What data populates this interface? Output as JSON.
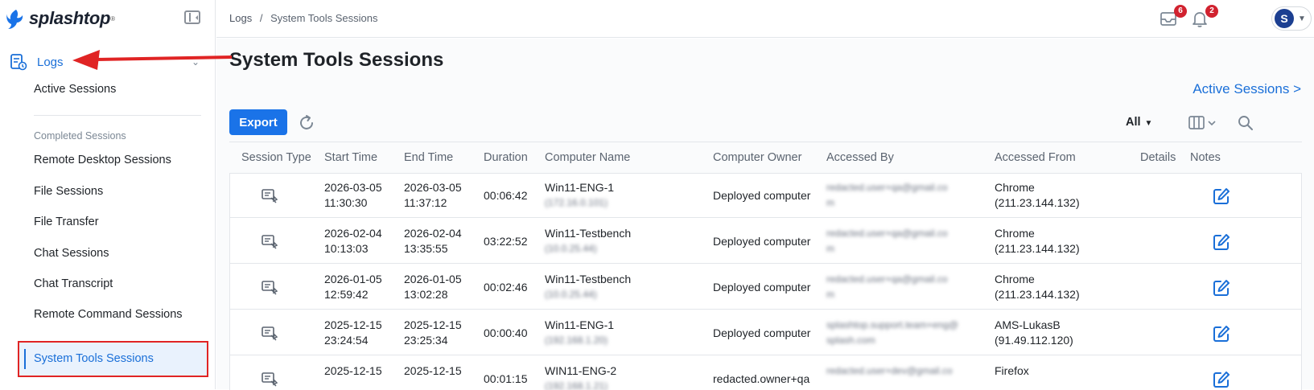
{
  "brand": {
    "name": "splashtop",
    "tm": "®"
  },
  "sidebar": {
    "logs_label": "Logs",
    "active_sessions": "Active Sessions",
    "section_label": "Completed Sessions",
    "items": [
      {
        "label": "Remote Desktop Sessions"
      },
      {
        "label": "File Sessions"
      },
      {
        "label": "File Transfer"
      },
      {
        "label": "Chat Sessions"
      },
      {
        "label": "Chat Transcript"
      },
      {
        "label": "Remote Command Sessions"
      }
    ],
    "selected_label": "System Tools Sessions"
  },
  "header": {
    "breadcrumb_root": "Logs",
    "breadcrumb_sep": "/",
    "breadcrumb_current": "System Tools Sessions",
    "inbox_badge": "6",
    "notif_badge": "2",
    "avatar_initial": "S"
  },
  "main": {
    "title": "System Tools Sessions",
    "active_sessions_link": "Active Sessions >",
    "export_label": "Export",
    "filter_value": "All",
    "columns": [
      "Session Type",
      "Start Time",
      "End Time",
      "Duration",
      "Computer Name",
      "Computer Owner",
      "Accessed By",
      "Accessed From",
      "Details",
      "Notes"
    ],
    "rows": [
      {
        "start_date": "2026-03-05",
        "start_time": "11:30:30",
        "end_date": "2026-03-05",
        "end_time": "11:37:12",
        "duration": "00:06:42",
        "computer": "Win11-ENG-1",
        "computer_sub": "(172.16.0.101)",
        "owner": "Deployed computer",
        "accessed_by": "redacted.user+qa@gmail.co",
        "accessed_by_2": "m",
        "from": "Chrome",
        "from_sub": "(211.23.144.132)"
      },
      {
        "start_date": "2026-02-04",
        "start_time": "10:13:03",
        "end_date": "2026-02-04",
        "end_time": "13:35:55",
        "duration": "03:22:52",
        "computer": "Win11-Testbench",
        "computer_sub": "(10.0.25.44)",
        "owner": "Deployed computer",
        "accessed_by": "redacted.user+qa@gmail.co",
        "accessed_by_2": "m",
        "from": "Chrome",
        "from_sub": "(211.23.144.132)"
      },
      {
        "start_date": "2026-01-05",
        "start_time": "12:59:42",
        "end_date": "2026-01-05",
        "end_time": "13:02:28",
        "duration": "00:02:46",
        "computer": "Win11-Testbench",
        "computer_sub": "(10.0.25.44)",
        "owner": "Deployed computer",
        "accessed_by": "redacted.user+qa@gmail.co",
        "accessed_by_2": "m",
        "from": "Chrome",
        "from_sub": "(211.23.144.132)"
      },
      {
        "start_date": "2025-12-15",
        "start_time": "23:24:54",
        "end_date": "2025-12-15",
        "end_time": "23:25:34",
        "duration": "00:00:40",
        "computer": "Win11-ENG-1",
        "computer_sub": "(192.168.1.20)",
        "owner": "Deployed computer",
        "accessed_by": "splashtop.support.team+eng@",
        "accessed_by_2": "splash.com",
        "from": "AMS-LukasB",
        "from_sub": "(91.49.112.120)"
      },
      {
        "start_date": "2025-12-15",
        "start_time": "",
        "end_date": "2025-12-15",
        "end_time": "",
        "duration": "00:01:15",
        "computer": "WIN11-ENG-2",
        "computer_sub": "(192.168.1.21)",
        "owner": "redacted.owner+qa",
        "accessed_by": "redacted.user+dev@gmail.co",
        "accessed_by_2": "",
        "from": "Firefox",
        "from_sub": ""
      }
    ]
  },
  "colors": {
    "accent": "#1a6fd8",
    "annotation": "#e02424",
    "badge": "#d1222f"
  },
  "icons": [
    "collapse-sidebar-icon",
    "logs-icon",
    "inbox-icon",
    "bell-icon",
    "refresh-icon",
    "columns-icon",
    "search-icon",
    "system-tools-icon",
    "edit-note-icon"
  ]
}
